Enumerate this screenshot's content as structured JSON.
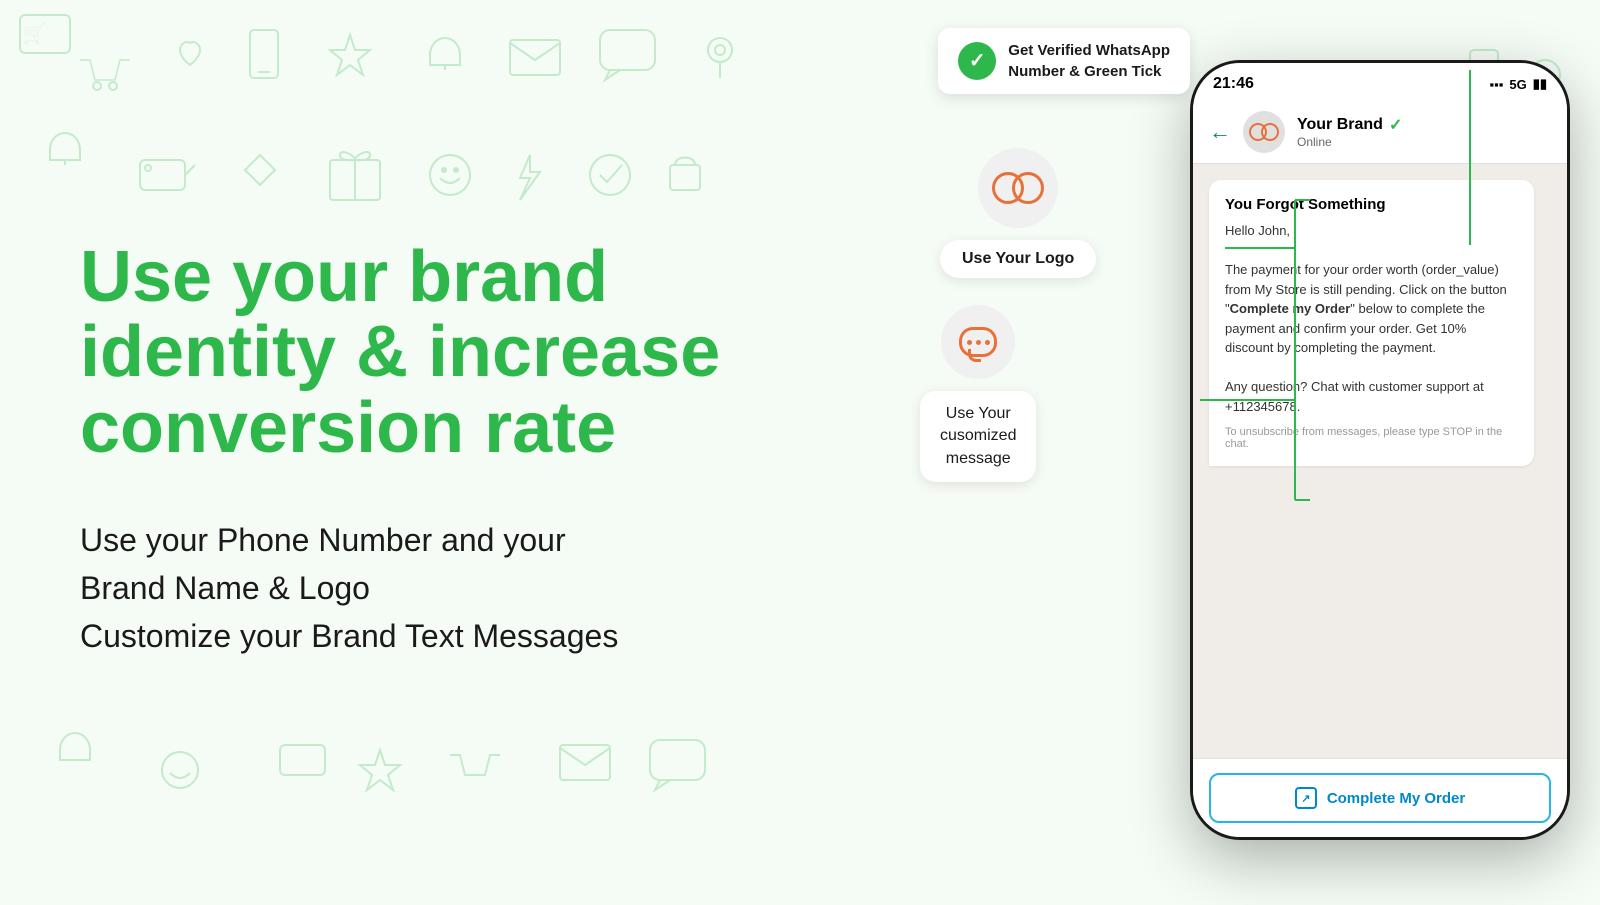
{
  "page": {
    "background_color": "#f5fcf5"
  },
  "left": {
    "headline": "Use your brand identity & increase conversion rate",
    "subtext_line1": "Use your Phone Number and your",
    "subtext_line2": "Brand Name & Logo",
    "subtext_line3": "Customize your Brand Text Messages"
  },
  "callouts": {
    "verified": {
      "label_line1": "Get Verified WhatsApp",
      "label_line2": "Number & Green Tick"
    },
    "logo": {
      "label": "Use Your Logo"
    },
    "message": {
      "label_line1": "Use Your",
      "label_line2": "cusomized",
      "label_line3": "message"
    }
  },
  "phone": {
    "status_time": "21:46",
    "status_signal": "5G",
    "contact_name": "Your Brand",
    "contact_status": "Online",
    "msg_title": "You Forgot Something",
    "msg_greeting": "Hello John,",
    "msg_body1": "The payment for your order worth (order_value) from My Store is still pending. Click on the button \"",
    "msg_bold": "Complete my Order",
    "msg_body2": "\" below to complete the payment and confirm your order. Get 10% discount by completing the payment.",
    "msg_body3": "Any question? Chat with customer support at +112345678.",
    "msg_unsubscribe": "To unsubscribe from messages, please type STOP in the chat.",
    "action_button_label": "Complete My Order"
  },
  "colors": {
    "green": "#2eb84b",
    "orange": "#e8713a",
    "blue": "#0088cc",
    "dark": "#1a1a1a",
    "light_bg": "#f5fcf5"
  }
}
